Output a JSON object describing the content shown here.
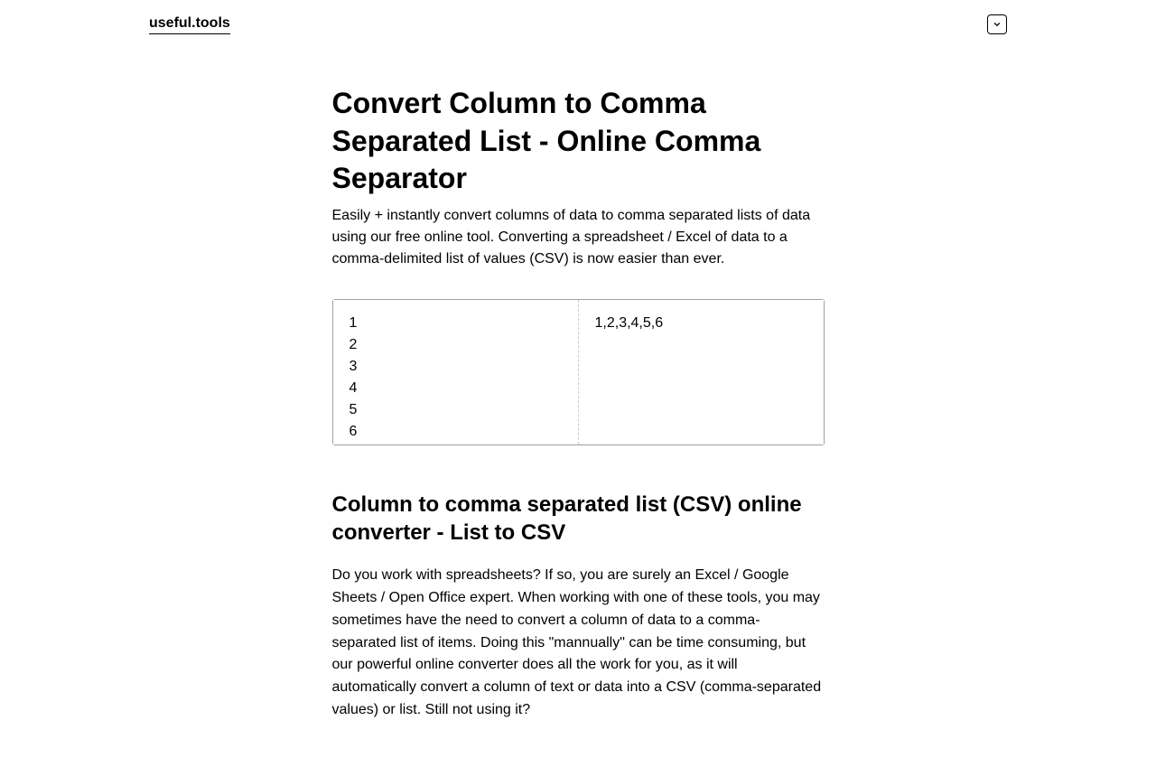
{
  "header": {
    "logo": "useful.tools"
  },
  "main": {
    "title": "Convert Column to Comma Separated List - Online Comma Separator",
    "subtitle": "Easily + instantly convert columns of data to comma separated lists of data using our free online tool. Converting a spreadsheet / Excel of data to a comma-delimited list of values (CSV) is now easier than ever.",
    "input_value": "1\n2\n3\n4\n5\n6",
    "output_value": "1,2,3,4,5,6",
    "section_heading": "Column to comma separated list (CSV) online converter - List to CSV",
    "section_body": "Do you work with spreadsheets? If so, you are surely an Excel / Google Sheets / Open Office expert. When working with one of these tools, you may sometimes have the need to convert a column of data to a comma-separated list of items. Doing this \"mannually\" can be time consuming, but our powerful online converter does all the work for you, as it will automatically convert a column of text or data into a CSV (comma-separated values) or list. Still not using it?"
  }
}
